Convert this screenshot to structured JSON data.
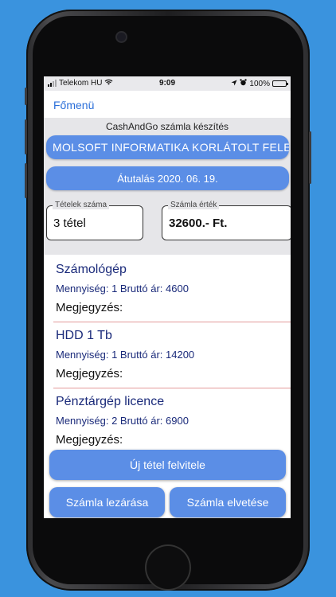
{
  "status": {
    "carrier": "Telekom HU",
    "time": "9:09",
    "battery": "100%",
    "battery_level": 1.0
  },
  "nav": {
    "back_label": "Főmenü"
  },
  "form": {
    "title": "CashAndGo számla készítés",
    "company": "MOLSOFT INFORMATIKA KORLÁTOLT FELE",
    "payment": "Átutalás 2020. 06. 19.",
    "items_count": {
      "label": "Tételek száma",
      "value": "3 tétel"
    },
    "invoice_value": {
      "label": "Számla érték",
      "value": "32600.- Ft."
    }
  },
  "items": [
    {
      "name": "Számológép",
      "detail": "Mennyiség: 1 Bruttó ár: 4600",
      "note": "Megjegyzés:"
    },
    {
      "name": "HDD  1 Tb",
      "detail": "Mennyiség: 1 Bruttó ár: 14200",
      "note": "Megjegyzés:"
    },
    {
      "name": "Pénztárgép licence",
      "detail": "Mennyiség: 2  Bruttó ár: 6900",
      "note": "Megjegyzés:"
    }
  ],
  "actions": {
    "new_item": "Új tétel felvitele",
    "close_invoice": "Számla lezárása",
    "cancel_invoice": "Számla elvetése"
  },
  "colors": {
    "accent": "#5b8ee6",
    "link": "#2b6fd9",
    "background": "#3a93de",
    "item_text": "#1a2a7a",
    "divider": "#e39a9a"
  }
}
